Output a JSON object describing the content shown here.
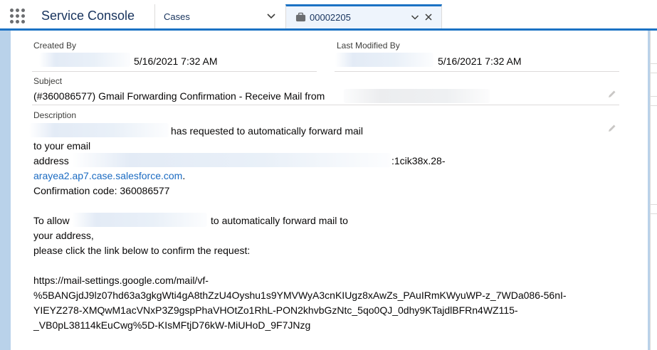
{
  "app": {
    "title": "Service Console"
  },
  "nav": {
    "object_label": "Cases"
  },
  "tab": {
    "label": "00002205"
  },
  "record": {
    "created_by": {
      "label": "Created By",
      "datetime": "5/16/2021 7:32 AM"
    },
    "last_modified_by": {
      "label": "Last Modified By",
      "datetime": "5/16/2021 7:32 AM"
    },
    "subject": {
      "label": "Subject",
      "value": "(#360086577) Gmail Forwarding Confirmation - Receive Mail from"
    },
    "description": {
      "label": "Description",
      "line1": "has requested to automatically forward mail",
      "line2": "to your email",
      "line3_prefix": "address",
      "line3_link": ":1cik38x.28-",
      "line4_link": "arayea2.ap7.case.salesforce.com",
      "line4_suffix": ".",
      "line5": "Confirmation code: 360086577",
      "line6_prefix": "To allow",
      "line6_suffix": "to automatically forward mail to",
      "line7": "your address,",
      "line8": "please click the link below to confirm the request:",
      "url_line1": "https://mail-settings.google.com/mail/vf-",
      "url_line2": "%5BANGjdJ9lz07hd63a3gkgWti4gA8thZzU4Oyshu1s9YMVWyA3cnKIUgz8xAwZs_PAuIRmKWyuWP-z_7WDa086-56nI-",
      "url_line3": "YIEYZ278-XMQwM1acVNxP3Z9gspPhaVHOtZo1RhL-PON2khvbGzNtc_5qo0QJ_0dhy9KTajdlBFRn4WZ115-",
      "url_line4": "_VB0pL38114kEuCwg%5D-KIsMFtjD76kW-MiUHoD_9F7JNzg"
    }
  },
  "colors": {
    "brand_blue": "#1b72c4",
    "link": "#1b6bc2",
    "background": "#b9d2ea"
  },
  "icons": [
    "app-launcher-icon",
    "chevron-down-icon",
    "case-icon",
    "close-icon",
    "pencil-icon"
  ]
}
